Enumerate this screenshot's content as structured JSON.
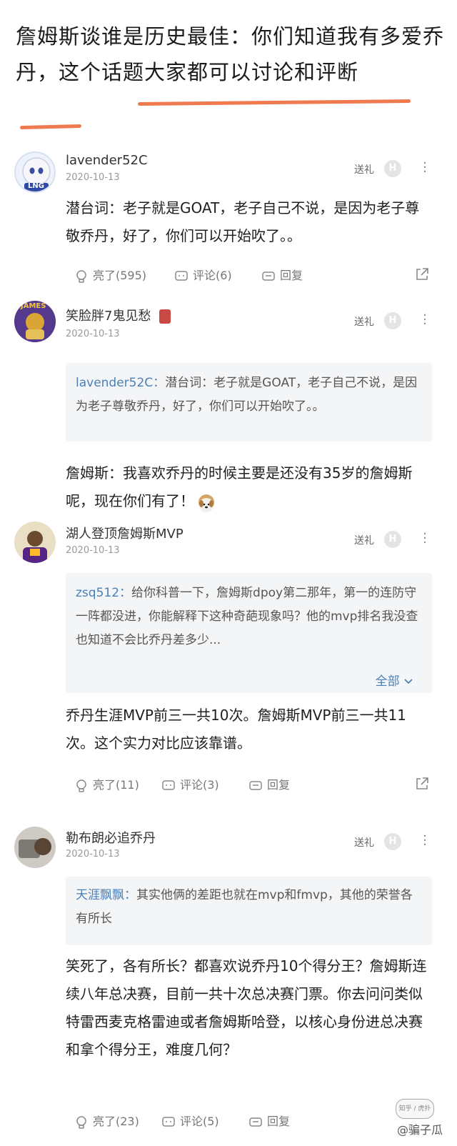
{
  "headline": "詹姆斯谈谁是历史最佳：你们知道我有多爱乔丹，这个话题大家都可以讨论和评断",
  "comments": [
    {
      "user": "lavender52C",
      "date": "2020-10-13",
      "gift": "送礼",
      "badge": "H",
      "avatar_text": "LNG",
      "text": "潜台词：老子就是GOAT，老子自己不说，是因为老子尊敬乔丹，好了，你们可以开始吹了。。",
      "likes": "亮了(595)",
      "comments": "评论(6)",
      "reply": "回复"
    },
    {
      "user": "笑脸胖7鬼见愁",
      "date": "2020-10-13",
      "gift": "送礼",
      "badge": "H",
      "avatar_text": "JAMES",
      "quote_name": "lavender52C：",
      "quote": "潜台词：老子就是GOAT，老子自己不说，是因为老子尊敬乔丹，好了，你们可以开始吹了。。",
      "text": "詹姆斯：我喜欢乔丹的时候主要是还没有35岁的詹姆斯呢，现在你们有了！"
    },
    {
      "user": "湖人登顶詹姆斯MVP",
      "date": "2020-10-13",
      "gift": "送礼",
      "badge": "H",
      "quote_name": "zsq512：",
      "quote": "给你科普一下，詹姆斯dpoy第二那年，第一的连防守一阵都没进，你能解释下这种奇葩现象吗？他的mvp排名我没查也知道不会比乔丹差多少...",
      "expand": "全部",
      "text": "乔丹生涯MVP前三一共10次。詹姆斯MVP前三一共11次。这个实力对比应该靠谱。",
      "likes": "亮了(11)",
      "comments": "评论(3)",
      "reply": "回复"
    },
    {
      "user": "勒布朗必追乔丹",
      "date": "2020-10-13",
      "gift": "送礼",
      "badge": "H",
      "quote_name": "天涯飘飘：",
      "quote": "其实他俩的差距也就在mvp和fmvp，其他的荣誉各有所长",
      "text": "笑死了，各有所长？都喜欢说乔丹10个得分王？詹姆斯连续八年总决赛，目前一共十次总决赛门票。你去问问类似特雷西麦克格雷迪或者詹姆斯哈登，以核心身份进总决赛和拿个得分王，难度几何？",
      "likes": "亮了(23)",
      "comments": "评论(5)",
      "reply": "回复"
    }
  ],
  "watermark": "@骗子瓜",
  "watermark_logo": "知乎 / 虎扑"
}
